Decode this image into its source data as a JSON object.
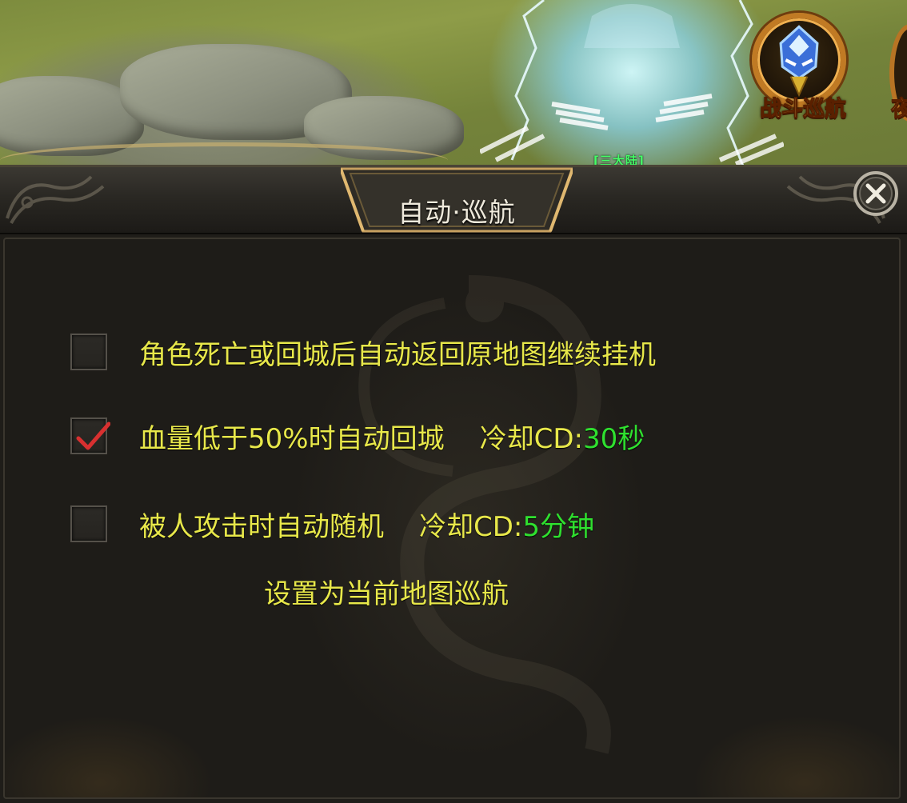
{
  "scene": {
    "character_label": "[三大陆]",
    "battle_cruise_button": {
      "label": "战斗巡航",
      "icon": "helmet-icon",
      "accent": "#c07a24"
    },
    "next_button_char": "夜"
  },
  "dialog": {
    "title": "自动·巡航",
    "close_icon": "close-icon",
    "options": [
      {
        "label": "角色死亡或回城后自动返回原地图继续挂机",
        "checked": false
      },
      {
        "label": "血量低于50%时自动回城",
        "cd_label": "冷却CD:",
        "cd_value": "30秒",
        "checked": true
      },
      {
        "label": "被人攻击时自动随机",
        "cd_label": "冷却CD:",
        "cd_value": "5分钟",
        "checked": false
      }
    ],
    "set_current_map_label": "设置为当前地图巡航"
  },
  "colors": {
    "option_text": "#e8e84a",
    "cd_value": "#2fe02f",
    "check_mark": "#d83030",
    "title_text": "#efeadc"
  }
}
